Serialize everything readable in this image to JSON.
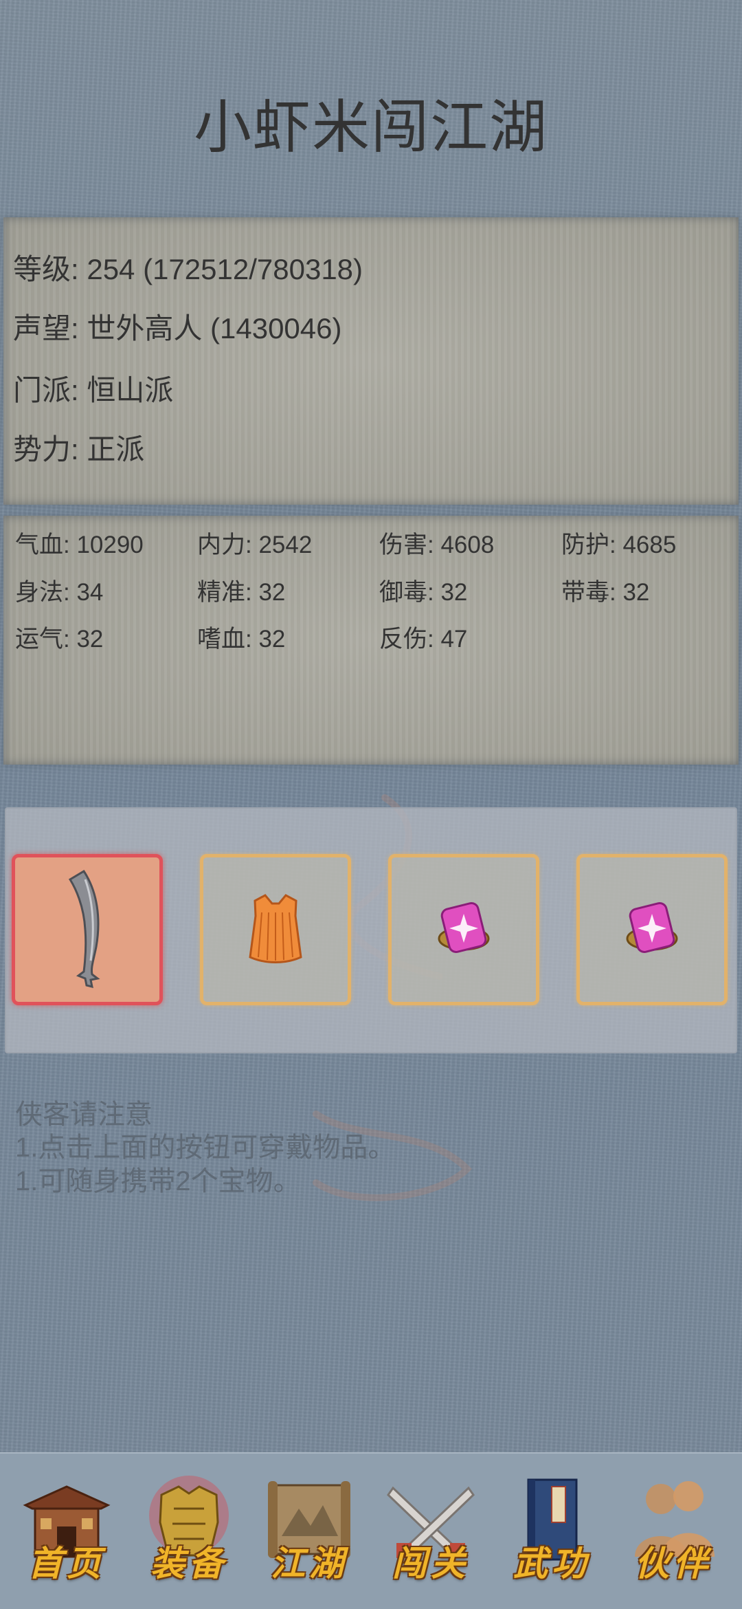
{
  "game": {
    "title": "小虾米闯江湖"
  },
  "profile": {
    "level": "等级: 254 (172512/780318)",
    "reputation": "声望: 世外高人 (1430046)",
    "sect": "门派: 恒山派",
    "faction": "势力:  正派"
  },
  "stats": {
    "row1": [
      "气血: 10290",
      "内力: 2542",
      "伤害: 4608",
      "防护: 4685"
    ],
    "row2": [
      "身法: 34",
      "精准: 32",
      "御毒: 32",
      "带毒: 32"
    ],
    "row3": [
      "运气: 32",
      "嗜血: 32",
      "反伤: 47"
    ]
  },
  "equipment": {
    "slots": [
      {
        "item": "sword-icon",
        "state": "selected",
        "accent": "#e0525a"
      },
      {
        "item": "robe-icon",
        "state": "normal",
        "accent": "#e2b26a"
      },
      {
        "item": "treasure-icon",
        "state": "normal",
        "accent": "#e2b26a"
      },
      {
        "item": "treasure-icon",
        "state": "normal",
        "accent": "#e2b26a"
      }
    ]
  },
  "notice": {
    "heading": "侠客请注意",
    "line1": "1.点击上面的按钮可穿戴物品。",
    "line2": "1.可随身携带2个宝物。"
  },
  "nav": {
    "items": [
      {
        "label": "首页",
        "icon": "house-icon"
      },
      {
        "label": "装备",
        "icon": "armor-icon",
        "active": true
      },
      {
        "label": "江湖",
        "icon": "scroll-map-icon"
      },
      {
        "label": "闯关",
        "icon": "crossed-swords-icon"
      },
      {
        "label": "武功",
        "icon": "book-icon"
      },
      {
        "label": "伙伴",
        "icon": "companions-icon"
      }
    ],
    "label_color": "#f0b429"
  }
}
